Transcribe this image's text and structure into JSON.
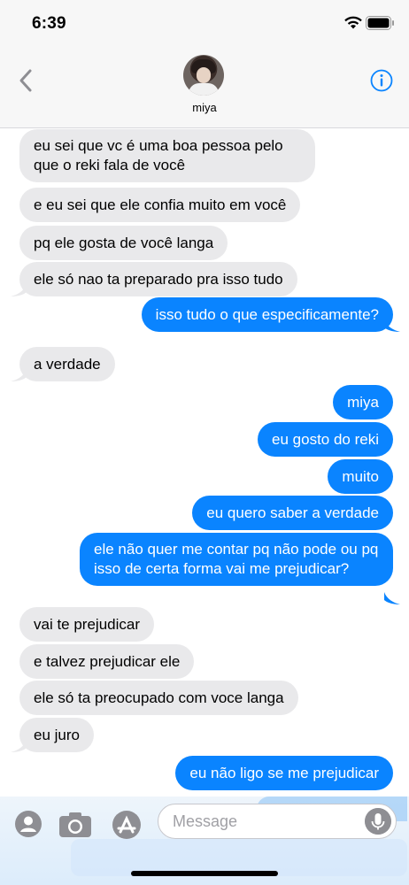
{
  "status_bar": {
    "time": "6:39"
  },
  "header": {
    "contact_name": "miya"
  },
  "messages": [
    {
      "side": "in",
      "text": "eu sei que vc é uma boa pessoa pelo que o reki fala de você"
    },
    {
      "side": "in",
      "text": "e eu sei que ele confia muito em você"
    },
    {
      "side": "in",
      "text": "pq ele gosta de você langa"
    },
    {
      "side": "in",
      "text": "ele só nao ta preparado pra isso tudo"
    },
    {
      "side": "out",
      "text": "isso tudo o que especificamente?"
    },
    {
      "side": "in",
      "text": "a verdade"
    },
    {
      "side": "out",
      "text": "miya"
    },
    {
      "side": "out",
      "text": "eu gosto do reki"
    },
    {
      "side": "out",
      "text": "muito"
    },
    {
      "side": "out",
      "text": "eu quero saber a verdade"
    },
    {
      "side": "out",
      "text": "ele não quer me contar pq não pode ou pq isso de certa forma vai me prejudicar?"
    },
    {
      "side": "in",
      "text": "vai te prejudicar"
    },
    {
      "side": "in",
      "text": "e talvez prejudicar ele"
    },
    {
      "side": "in",
      "text": "ele só ta preocupado com voce langa"
    },
    {
      "side": "in",
      "text": "eu juro"
    },
    {
      "side": "out",
      "text": "eu não ligo se me prejudicar"
    }
  ],
  "compose": {
    "placeholder": "Message"
  },
  "icons": {
    "back": "chevron-left-icon",
    "info": "info-icon",
    "apps": [
      "contact-app-icon",
      "camera-icon",
      "app-store-icon"
    ],
    "mic": "microphone-icon"
  },
  "colors": {
    "accent": "#0a84ff",
    "incoming_bubble": "#e9e9eb"
  }
}
